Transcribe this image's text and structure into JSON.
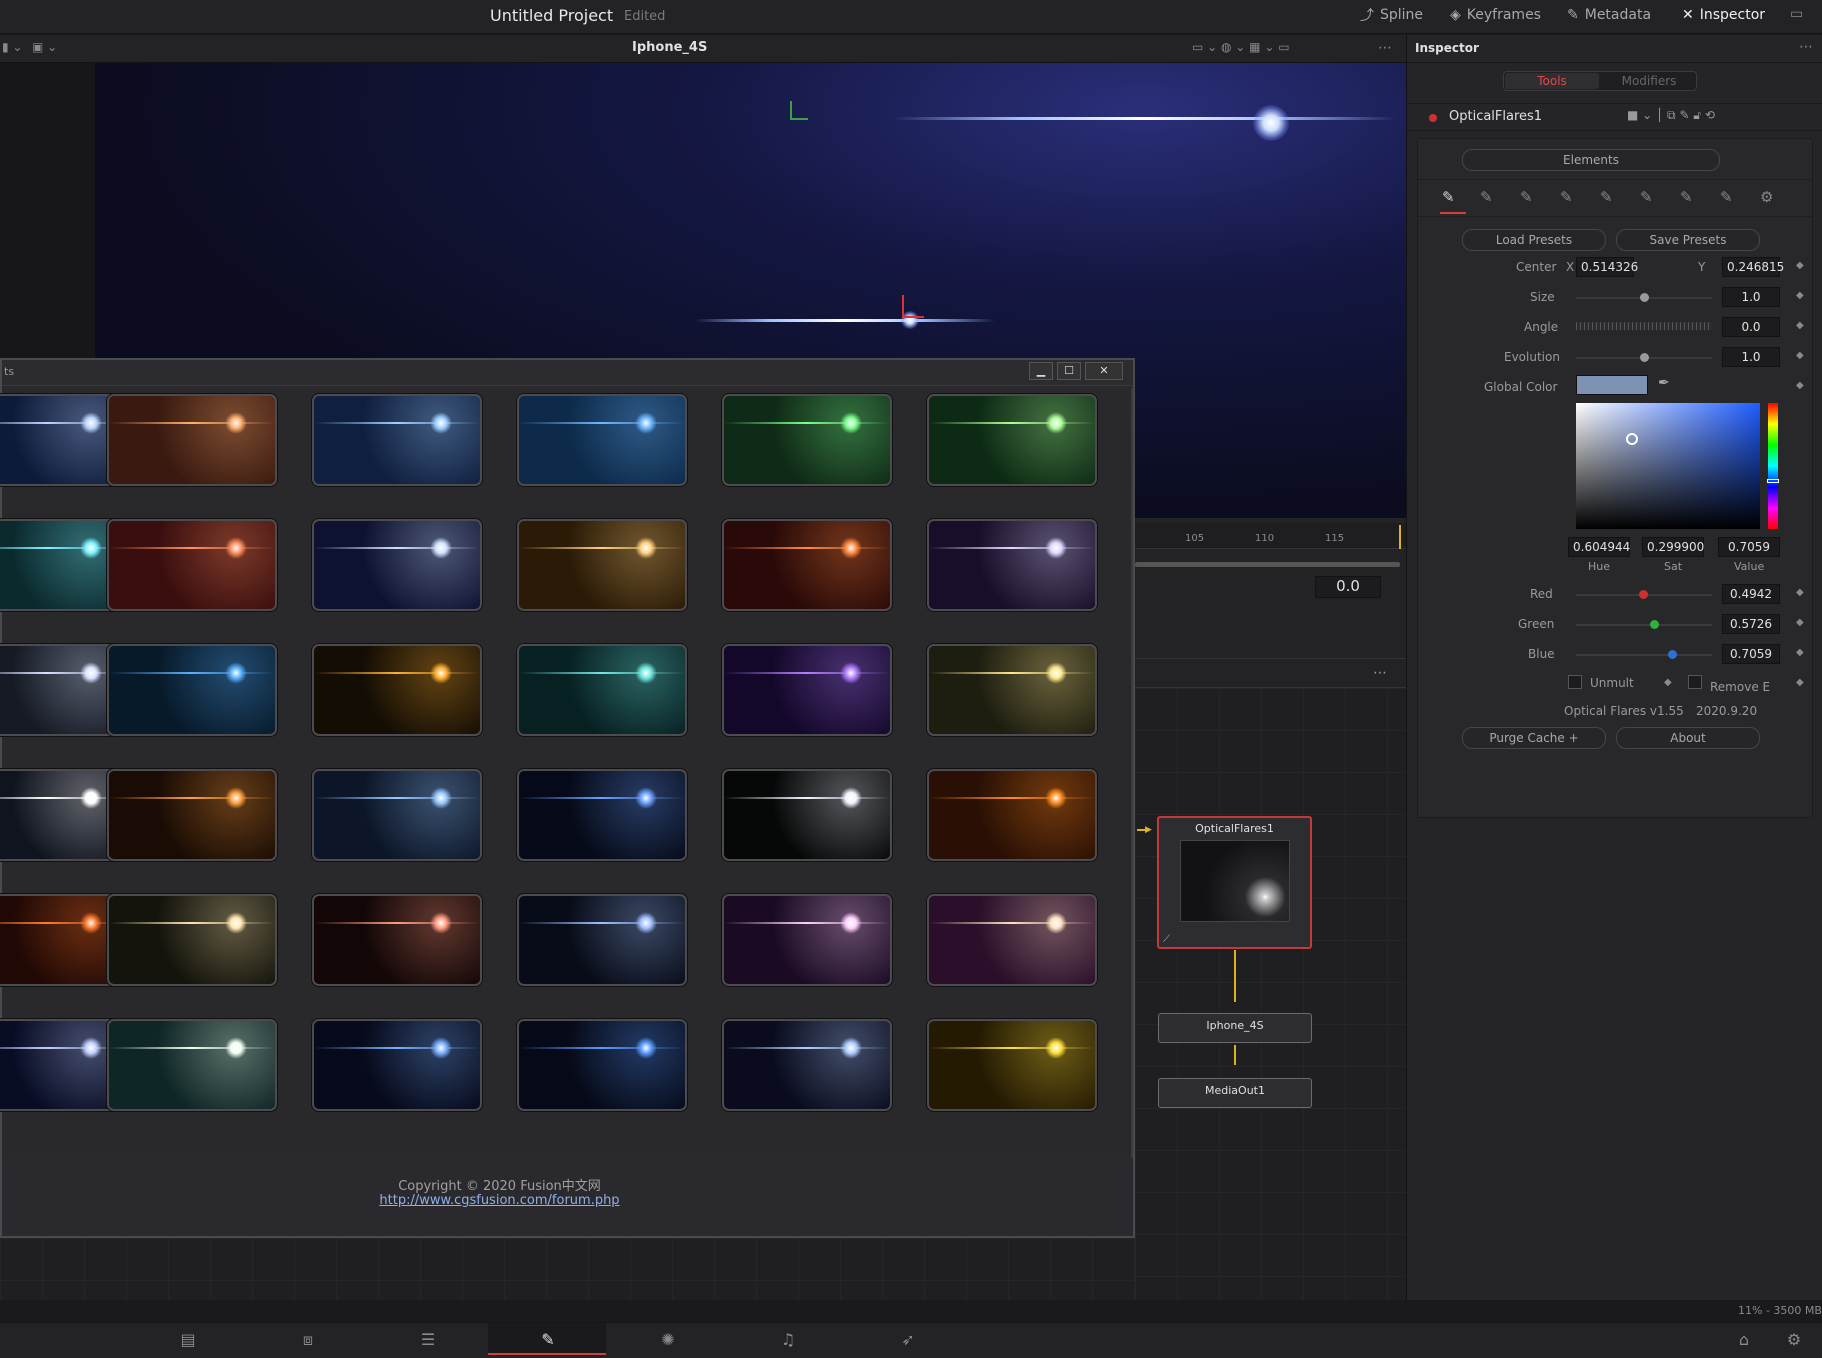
{
  "topbar": {
    "title": "Untitled Project",
    "status": "Edited",
    "tabs": [
      {
        "label": "Spline",
        "icon": "spline-icon"
      },
      {
        "label": "Keyframes",
        "icon": "keyframes-icon"
      },
      {
        "label": "Metadata",
        "icon": "metadata-icon"
      },
      {
        "label": "Inspector",
        "icon": "inspector-icon"
      }
    ]
  },
  "viewer": {
    "name": "Iphone_4S"
  },
  "timeline": {
    "ruler": [
      "105",
      "110",
      "115"
    ],
    "value": "0.0"
  },
  "dialog": {
    "title_fragment": "ts",
    "copyright": "Copyright © 2020 Fusion中文网",
    "link": "http://www.cgsfusion.com/forum.php",
    "buttons": {
      "minimize": "▁",
      "maximize": "☐",
      "close": "✕"
    }
  },
  "presets": [
    {
      "bg": "#0e1a3a",
      "flare": "#bcd4ff"
    },
    {
      "bg": "#3a1a10",
      "flare": "#ffb070"
    },
    {
      "bg": "#0f1f3f",
      "flare": "#9fd0ff"
    },
    {
      "bg": "#0d2a4a",
      "flare": "#6fb8ff"
    },
    {
      "bg": "#0f2a16",
      "flare": "#7dff8f"
    },
    {
      "bg": "#0d2a14",
      "flare": "#b0ff9a"
    },
    {
      "bg": "#0b2a2e",
      "flare": "#7ef3ff"
    },
    {
      "bg": "#3a0e0e",
      "flare": "#ff9060"
    },
    {
      "bg": "#0d1230",
      "flare": "#cfe3ff"
    },
    {
      "bg": "#2a1a06",
      "flare": "#ffd080"
    },
    {
      "bg": "#2a0a08",
      "flare": "#ff8a40"
    },
    {
      "bg": "#180e2a",
      "flare": "#e0d8ff"
    },
    {
      "bg": "#151a24",
      "flare": "#d8e4ff"
    },
    {
      "bg": "#071a2a",
      "flare": "#5ab0ff"
    },
    {
      "bg": "#140d04",
      "flare": "#ffb030"
    },
    {
      "bg": "#072022",
      "flare": "#70e8e0"
    },
    {
      "bg": "#14082a",
      "flare": "#b080ff"
    },
    {
      "bg": "#1e1e10",
      "flare": "#ffe890"
    },
    {
      "bg": "#10141e",
      "flare": "#ffffff"
    },
    {
      "bg": "#1a0c04",
      "flare": "#ffa040"
    },
    {
      "bg": "#0c1628",
      "flare": "#9ac8ff"
    },
    {
      "bg": "#060a18",
      "flare": "#6aa0ff"
    },
    {
      "bg": "#060808",
      "flare": "#f0f4ff"
    },
    {
      "bg": "#2a1004",
      "flare": "#ff8c20"
    },
    {
      "bg": "#200804",
      "flare": "#ff7a30"
    },
    {
      "bg": "#14140c",
      "flare": "#ffe6b0"
    },
    {
      "bg": "#120606",
      "flare": "#ff9c80"
    },
    {
      "bg": "#080c18",
      "flare": "#a0c0ff"
    },
    {
      "bg": "#1a0a22",
      "flare": "#ffd0ff"
    },
    {
      "bg": "#2a0e2a",
      "flare": "#ffe0c0"
    },
    {
      "bg": "#080c24",
      "flare": "#c0d0ff"
    },
    {
      "bg": "#0e2626",
      "flare": "#f0fff0"
    },
    {
      "bg": "#060a1a",
      "flare": "#7ab0ff"
    },
    {
      "bg": "#060a18",
      "flare": "#5a9aff"
    },
    {
      "bg": "#0a0c1e",
      "flare": "#b0d0ff"
    },
    {
      "bg": "#241a02",
      "flare": "#ffe040"
    }
  ],
  "inspector": {
    "title": "Inspector",
    "tabs": [
      "Tools",
      "Modifiers"
    ],
    "node_name": "OpticalFlares1",
    "elements_button": "Elements",
    "load_presets": "Load Presets",
    "save_presets": "Save Presets",
    "center_label": "Center",
    "x_label": "X",
    "y_label": "Y",
    "center_x": "0.514326",
    "center_y": "0.246815",
    "size_label": "Size",
    "size": "1.0",
    "size_fraction": 0.5,
    "angle_label": "Angle",
    "angle": "0.0",
    "evolution_label": "Evolution",
    "evolution": "1.0",
    "evolution_fraction": 0.5,
    "global_color_label": "Global Color",
    "global_color": "#7e92b4",
    "hue": "0.604944",
    "sat": "0.299900",
    "value": "0.7059",
    "hue_label": "Hue",
    "sat_label": "Sat",
    "value_label": "Value",
    "red_label": "Red",
    "red": "0.4942",
    "red_fraction": 0.4942,
    "green_label": "Green",
    "green": "0.5726",
    "green_fraction": 0.5726,
    "blue_label": "Blue",
    "blue": "0.7059",
    "blue_fraction": 0.7059,
    "unmult_label": "Unmult",
    "remove_label": "Remove E",
    "version": "Optical Flares  v1.55",
    "date": "2020.9.20",
    "purge_button": "Purge Cache +",
    "about_button": "About"
  },
  "nodes": {
    "flares": "OpticalFlares1",
    "iphone": "Iphone_4S",
    "mediaout": "MediaOut1"
  },
  "status": {
    "memory": "11% - 3500 MB"
  }
}
